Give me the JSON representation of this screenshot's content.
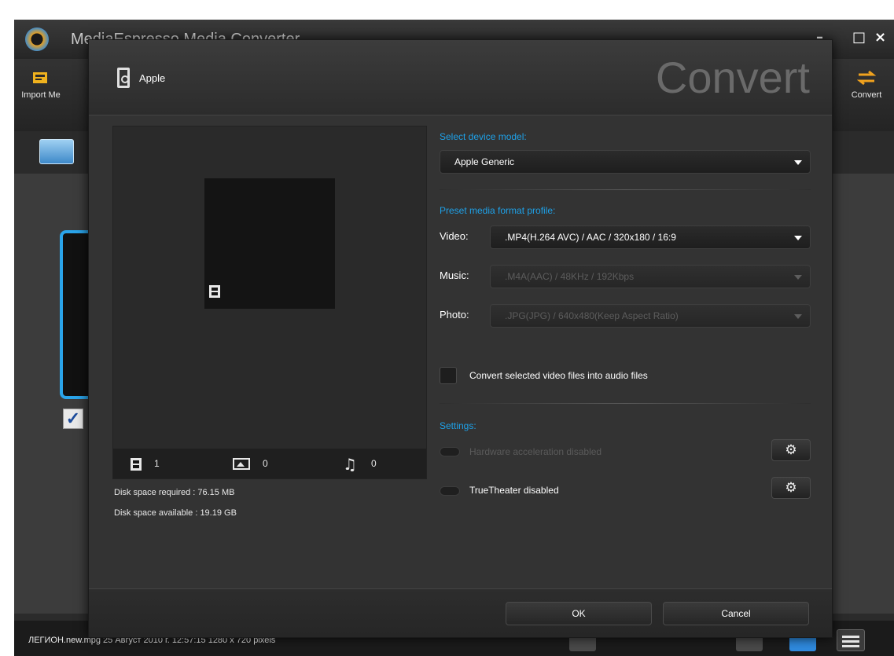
{
  "background_app": {
    "title": "MediaEspresso Media Converter",
    "import_label": "Import Me",
    "convert_label": "Convert",
    "status_text": "ЛЕГИОН.new.mpg  25 Август 2010 г. 12:57:15  1280 x 720 pixels"
  },
  "dialog": {
    "device_name": "Apple",
    "title": "Convert",
    "select_device_label": "Select device model:",
    "device_model": "Apple Generic",
    "preset_label": "Preset media format profile:",
    "video_label": "Video:",
    "video_value": ".MP4(H.264 AVC) / AAC / 320x180 / 16:9",
    "music_label": "Music:",
    "music_value": ".M4A(AAC) / 48KHz / 192Kbps",
    "photo_label": "Photo:",
    "photo_value": ".JPG(JPG) / 640x480(Keep Aspect Ratio)",
    "convert_to_audio_label": "Convert selected video files into audio files",
    "settings_label": "Settings:",
    "hw_accel_label": "Hardware acceleration disabled",
    "truetheater_label": "TrueTheater disabled",
    "video_count": "1",
    "photo_count": "0",
    "music_count": "0",
    "disk_required": "Disk space required : 76.15 MB",
    "disk_available": "Disk space available : 19.19 GB",
    "ok_label": "OK",
    "cancel_label": "Cancel"
  },
  "icons": {
    "gear": "⚙",
    "music": "♫",
    "check": "✓",
    "minimize": "–",
    "maximize": "□",
    "close": "×"
  },
  "colors": {
    "accent": "#1ea1e8",
    "title_gray": "#6a6a6a"
  }
}
